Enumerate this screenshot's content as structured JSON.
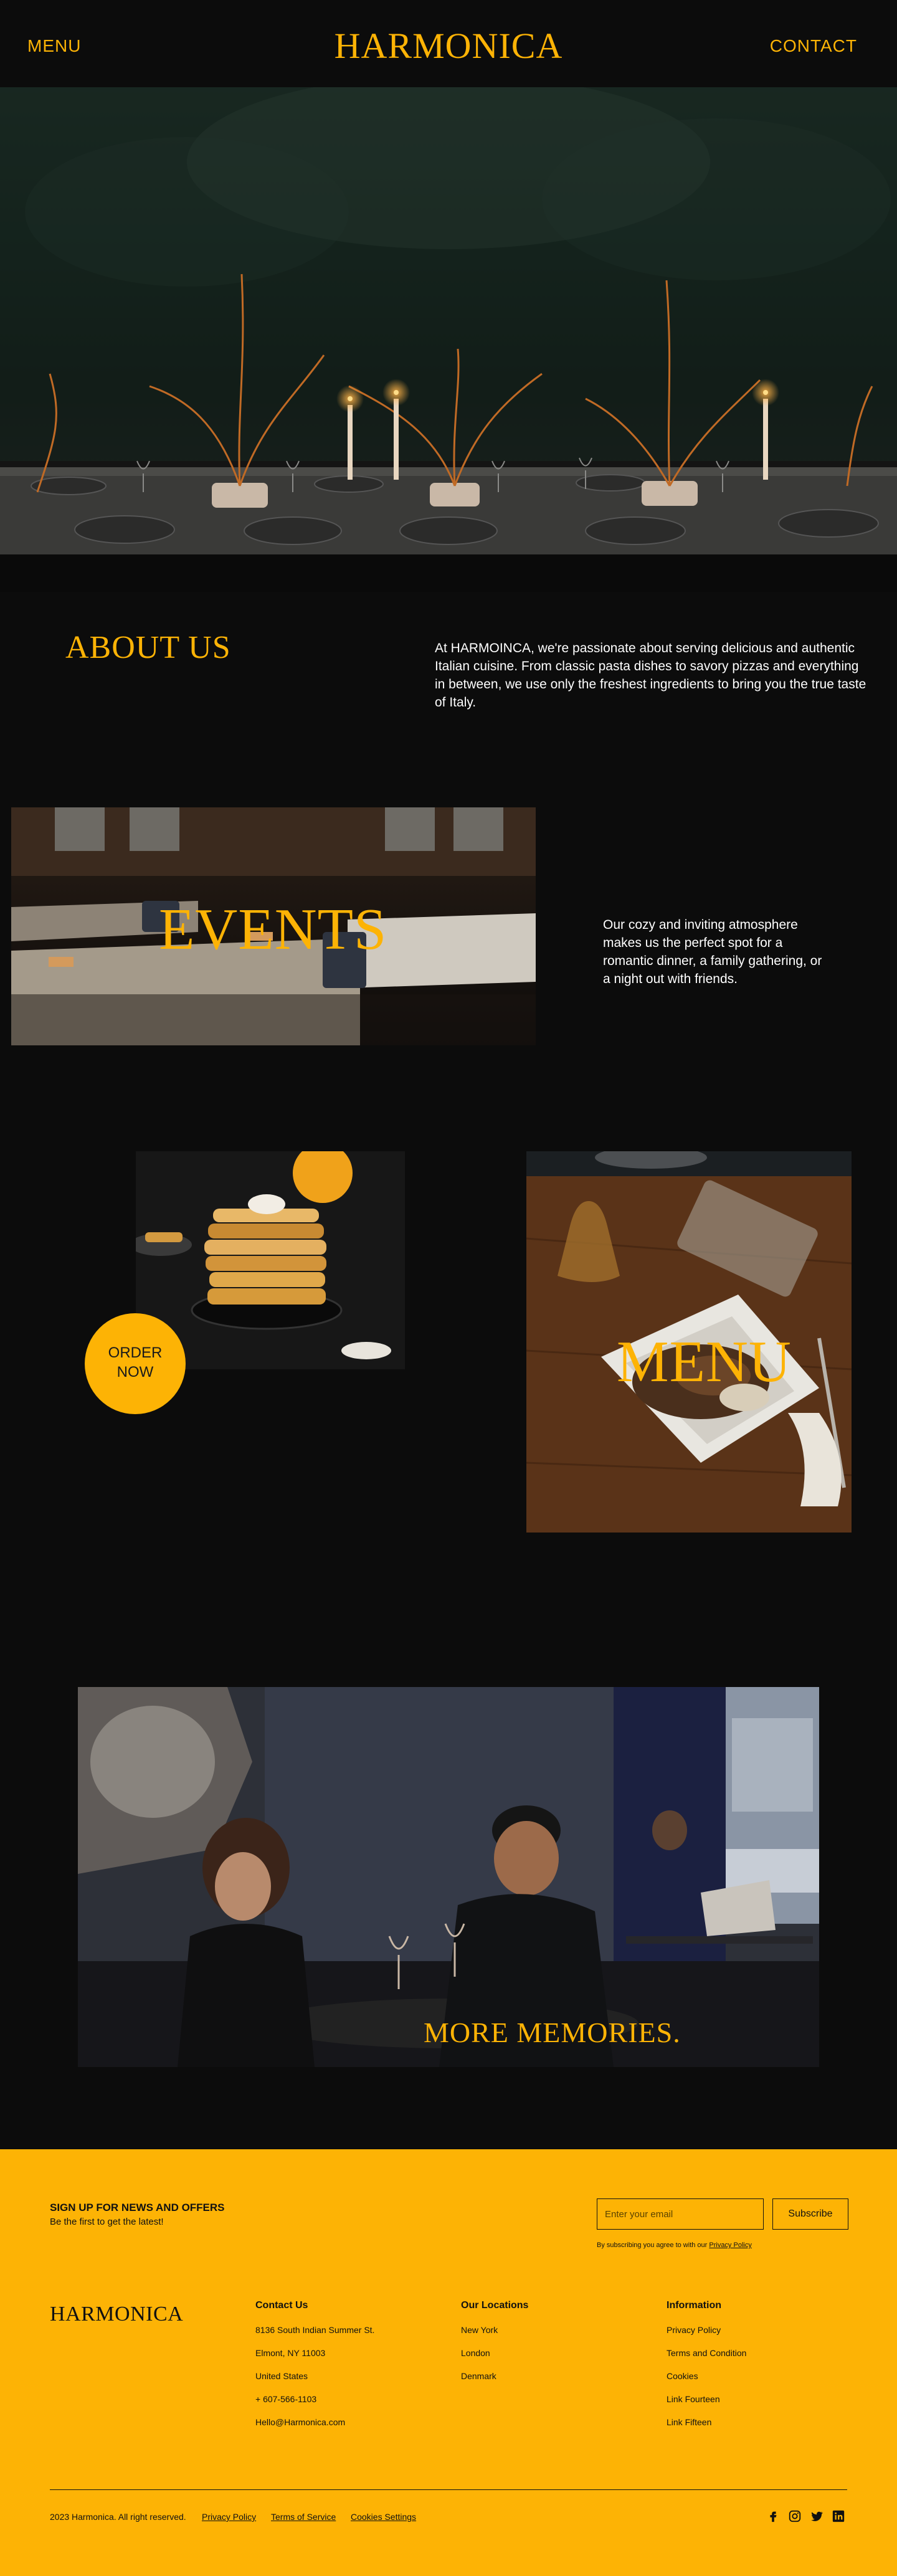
{
  "header": {
    "menu_label": "MENU",
    "brand": "HARMONICA",
    "contact_label": "CONTACT"
  },
  "about": {
    "title": "ABOUT US",
    "text": "At HARMOINCA, we're passionate about serving delicious and authentic Italian cuisine. From classic pasta dishes to savory pizzas and everything in between, we use only the freshest ingredients to bring you the true taste of Italy."
  },
  "events": {
    "title": "EVENTS",
    "text": "Our cozy and inviting atmosphere makes us the perfect spot for a romantic dinner, a family gathering, or a night out with friends."
  },
  "order": {
    "line1": "ORDER",
    "line2": "NOW"
  },
  "menu_section": {
    "title": "MENU"
  },
  "memories": {
    "title": "MORE MEMORIES."
  },
  "footer": {
    "newsletter": {
      "title": "SIGN UP FOR NEWS AND OFFERS",
      "subtitle": "Be the first to get the latest!",
      "email_placeholder": "Enter your email",
      "subscribe_label": "Subscribe",
      "legal_prefix": "By subscribing you agree to with our ",
      "legal_link": "Privacy Policy"
    },
    "brand": "HARMONICA",
    "contact": {
      "title": "Contact Us",
      "lines": [
        "8136 South Indian Summer St.",
        "Elmont, NY 11003",
        "United States",
        "+ 607-566-1103",
        "Hello@Harmonica.com"
      ]
    },
    "locations": {
      "title": "Our Locations",
      "lines": [
        "New York",
        "London",
        "Denmark"
      ]
    },
    "information": {
      "title": "Information",
      "lines": [
        "Privacy Policy",
        "Terms and Condition",
        "Cookies",
        "Link Fourteen",
        "Link Fifteen"
      ]
    },
    "copyright": "2023 Harmonica. All right reserved.",
    "legal_links": [
      "Privacy Policy",
      "Terms of Service",
      "Cookies Settings"
    ],
    "social_icons": [
      "facebook-icon",
      "instagram-icon",
      "twitter-icon",
      "linkedin-icon"
    ]
  },
  "colors": {
    "accent": "#fdb305",
    "background": "#0c0c0c",
    "footer_text": "#111111"
  }
}
